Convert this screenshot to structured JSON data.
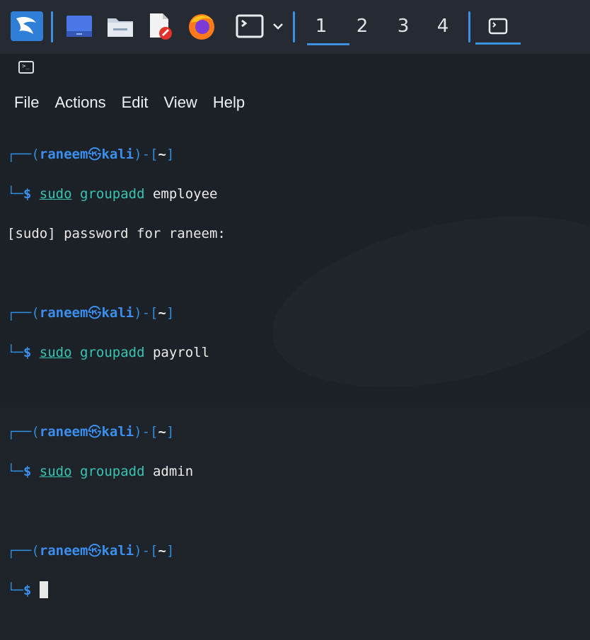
{
  "taskbar": {
    "workspaces": [
      "1",
      "2",
      "3",
      "4"
    ],
    "active_workspace": "1"
  },
  "menu": [
    "File",
    "Actions",
    "Edit",
    "View",
    "Help"
  ],
  "prompt": {
    "user": "raneem",
    "host": "kali",
    "dir": "~"
  },
  "blocks": [
    {
      "cmd": "groupadd",
      "arg": "employee",
      "sudo": "sudo",
      "output": "[sudo] password for raneem:"
    },
    {
      "cmd": "groupadd",
      "arg": "payroll",
      "sudo": "sudo"
    },
    {
      "cmd": "groupadd",
      "arg": "admin",
      "sudo": "sudo"
    }
  ],
  "icons": {
    "kali": "kali-dragon-icon",
    "desktop": "desktop-icon",
    "files": "folder-icon",
    "editor": "text-editor-icon",
    "browser": "firefox-icon",
    "terminal": "terminal-icon",
    "dropdown": "chevron-down-icon"
  },
  "colors": {
    "accent": "#3d8fe0",
    "prompt_blue": "#3b8ff0",
    "command_teal": "#38c3b3",
    "background": "#1c2127"
  }
}
